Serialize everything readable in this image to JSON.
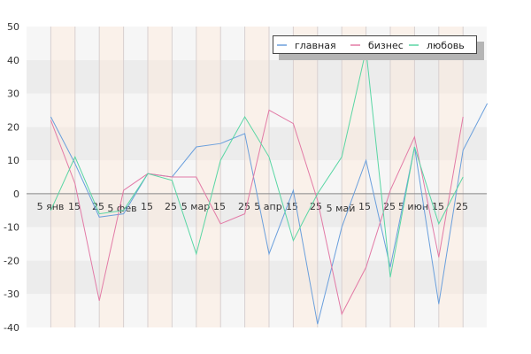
{
  "chart_data": {
    "type": "line",
    "x": [
      "2.jan",
      "9.jan",
      "16.jan",
      "23.jan",
      "30.jan",
      "6.feb",
      "13.feb",
      "20.feb",
      "27.feb",
      "6.mar",
      "13.mar",
      "20.mar",
      "27.mar",
      "3.apr",
      "10.apr",
      "17.apr",
      "24.apr",
      "1.may",
      "8.may",
      "15.may",
      "22.may",
      "29.may",
      "5.jun",
      "12.jun",
      "19.jun"
    ],
    "x_tick_labels": [
      "5 янв",
      "15",
      "25",
      "5 фев",
      "15",
      "25",
      "5 мар",
      "15",
      "25",
      "5 апр",
      "15",
      "25",
      "5 май",
      "15",
      "25",
      "5 июн",
      "15",
      "25"
    ],
    "series": [
      {
        "name": "главная",
        "color": "#6a9fdc",
        "values": [
          23,
          9,
          -7,
          -6,
          6,
          5,
          14,
          15,
          18,
          -18,
          1,
          -39,
          -10,
          10,
          -22,
          14,
          -33,
          13,
          27
        ]
      },
      {
        "name": "бизнес",
        "color": "#e27aa6",
        "values": [
          22,
          3,
          -32,
          1,
          6,
          5,
          5,
          -9,
          -6,
          25,
          21,
          -2,
          -36,
          -22,
          1,
          17,
          -19,
          23
        ]
      },
      {
        "name": "любовь",
        "color": "#5ad6a4",
        "values": [
          -5,
          11,
          -6,
          -5,
          6,
          4,
          -18,
          10,
          23,
          11,
          -14,
          0,
          11,
          43,
          -25,
          14,
          -9,
          5
        ]
      }
    ],
    "ylim": [
      -40,
      50
    ],
    "y_ticks": [
      -40,
      -30,
      -20,
      -10,
      0,
      10,
      20,
      30,
      40,
      50
    ],
    "grid": true,
    "legend_position": "top-right"
  }
}
